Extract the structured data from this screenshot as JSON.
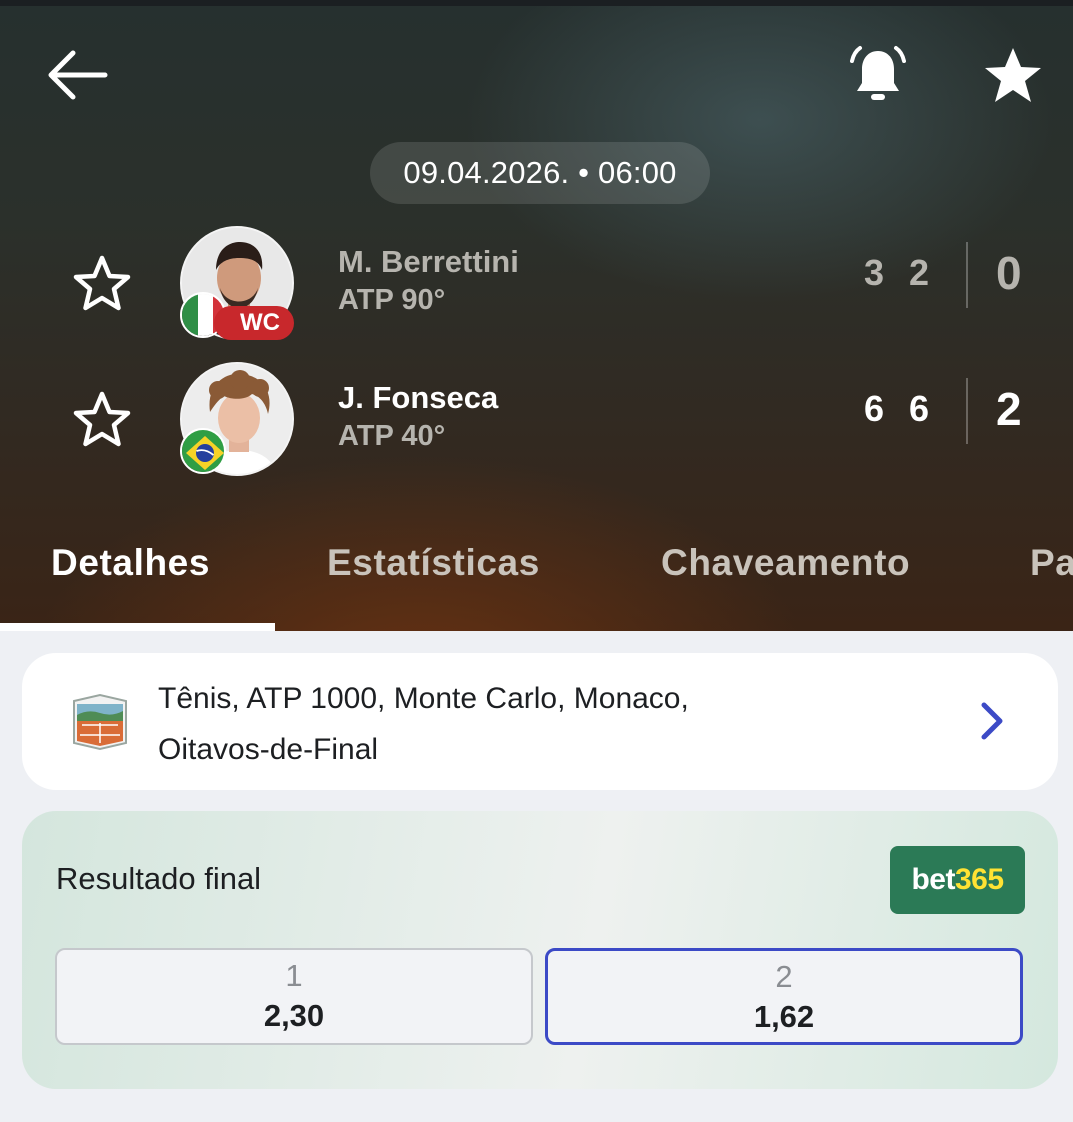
{
  "header": {
    "back_icon": "arrow-left-icon",
    "bell_icon": "bell-ringing-icon",
    "favorite_icon": "star-filled-icon",
    "date_time": "09.04.2026. • 06:00"
  },
  "players": [
    {
      "name": "M. Berrettini",
      "rank": "ATP 90°",
      "country_flag": "italy",
      "badge": "WC",
      "set_scores": [
        "3",
        "2"
      ],
      "sets_won": "0",
      "favorite_icon": "star-outline-icon"
    },
    {
      "name": "J. Fonseca",
      "rank": "ATP 40°",
      "country_flag": "brazil",
      "set_scores": [
        "6",
        "6"
      ],
      "sets_won": "2",
      "favorite_icon": "star-outline-icon"
    }
  ],
  "tabs": [
    {
      "label": "Detalhes",
      "active": true
    },
    {
      "label": "Estatísticas",
      "active": false
    },
    {
      "label": "Chaveamento",
      "active": false
    },
    {
      "label": "Pa",
      "active": false
    }
  ],
  "tournament": {
    "line1": "Tênis, ATP 1000, Monte Carlo, Monaco,",
    "line2": "Oitavos-de-Final",
    "icon": "clay-court-icon",
    "chevron": "chevron-right-icon"
  },
  "odds": {
    "title": "Resultado final",
    "bookmaker_part1": "bet",
    "bookmaker_part2": "365",
    "options": [
      {
        "label": "1",
        "value": "2,30"
      },
      {
        "label": "2",
        "value": "1,62"
      }
    ]
  },
  "colors": {
    "accent_blue": "#3c4ac6",
    "bet365_green": "#2b7a56",
    "bet365_yellow": "#ffe233",
    "wc_red": "#c8282c"
  }
}
